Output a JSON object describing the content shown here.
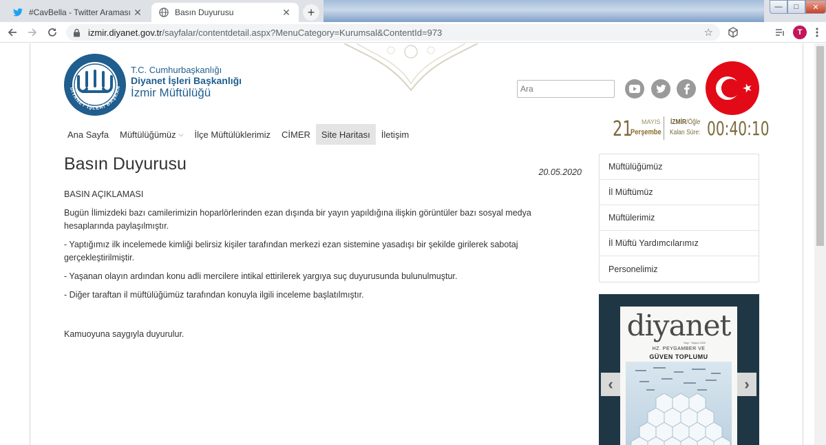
{
  "browser": {
    "tabs": [
      {
        "title": "#CavBella - Twitter Araması / Twi",
        "favicon": "twitter-icon",
        "active": false
      },
      {
        "title": "Basın Duyurusu",
        "favicon": "globe-icon",
        "active": true
      }
    ],
    "new_tab_label": "+",
    "window_controls": {
      "minimize": "—",
      "maximize": "□",
      "close": "✕"
    },
    "address": {
      "host": "izmir.diyanet.gov.tr",
      "path": "/sayfalar/contentdetail.aspx?MenuCategory=Kurumsal&ContentId=973"
    },
    "profile_initial": "T"
  },
  "site": {
    "brand": {
      "line1": "T.C. Cumhurbaşkanlığı",
      "line2": "Diyanet İşleri Başkanlığı",
      "line3": "İzmir Müftülüğü",
      "logo_text": "DİYANET İŞLERİ BAŞKANLIĞI"
    },
    "search": {
      "placeholder": "Ara"
    },
    "social": [
      "youtube-icon",
      "twitter-icon",
      "facebook-icon"
    ],
    "prayer": {
      "day": "21",
      "month": "MAYIS",
      "weekday": "Perşembe",
      "city": "İZMİR",
      "prayer_name": "/Öğle",
      "remaining_label": "Kalan Süre:",
      "remaining_time": "00:40:10"
    },
    "menu": [
      {
        "label": "Ana Sayfa",
        "has_dropdown": false,
        "highlighted": false
      },
      {
        "label": "Müftülüğümüz",
        "has_dropdown": true,
        "highlighted": false
      },
      {
        "label": "İlçe Müftülüklerimiz",
        "has_dropdown": false,
        "highlighted": false
      },
      {
        "label": "CİMER",
        "has_dropdown": false,
        "highlighted": false
      },
      {
        "label": "Site Haritası",
        "has_dropdown": false,
        "highlighted": true
      },
      {
        "label": "İletişim",
        "has_dropdown": false,
        "highlighted": false
      }
    ]
  },
  "article": {
    "title": "Basın Duyurusu",
    "date": "20.05.2020",
    "paragraphs": [
      "BASIN AÇIKLAMASI",
      "Bugün İlimizdeki bazı camilerimizin hoparlörlerinden ezan dışında bir yayın yapıldığına ilişkin görüntüler bazı sosyal medya hesaplarında paylaşılmıştır.",
      "- Yaptığımız ilk incelemede kimliği belirsiz kişiler tarafından merkezi ezan sistemine yasadışı bir şekilde girilerek sabotaj gerçekleştirilmiştir.",
      "- Yaşanan olayın ardından konu adli mercilere intikal ettirilerek yargıya suç duyurusunda bulunulmuştur.",
      "- Diğer taraftan il müftülüğümüz tarafından konuyla ilgili inceleme başlatılmıştır."
    ],
    "closing": "Kamuoyuna saygıyla duyurulur."
  },
  "sidebar": {
    "items": [
      {
        "label": "Müftülüğümüz"
      },
      {
        "label": "İl Müftümüz"
      },
      {
        "label": "Müftülerimiz"
      },
      {
        "label": "İl Müftü Yardımcılarımız"
      },
      {
        "label": "Personelimiz"
      }
    ]
  },
  "magazine": {
    "title": "diyanet",
    "meta": "Sayı · Mayıs 2020",
    "subtitle1": "HZ. PEYGAMBER VE",
    "subtitle2": "GÜVEN TOPLUMU",
    "prev": "‹",
    "next": "›"
  },
  "colors": {
    "brand_blue": "#1f5e8e",
    "flag_red": "#e30a17",
    "magazine_bg": "#1f3744"
  }
}
